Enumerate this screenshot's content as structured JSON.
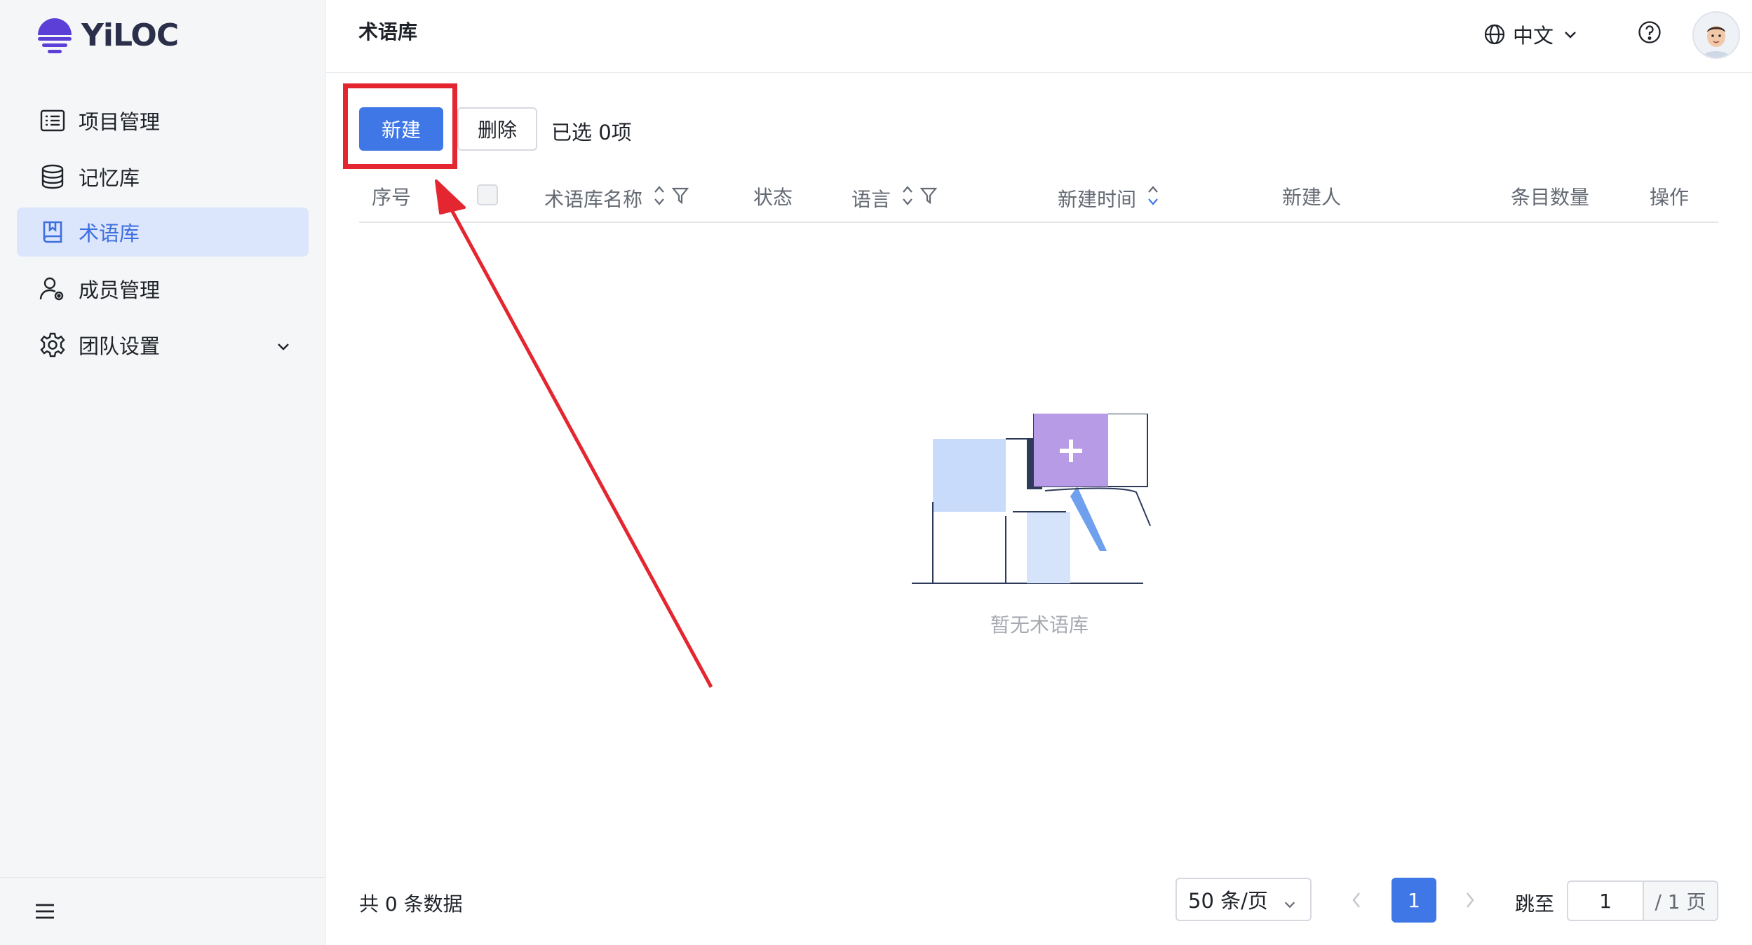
{
  "app": {
    "name": "YiLOC",
    "brand_color": "#5b3fd6",
    "accent": "#3f78e6"
  },
  "sidebar": {
    "items": [
      {
        "label": "项目管理",
        "icon": "project-list-icon"
      },
      {
        "label": "记忆库",
        "icon": "database-icon"
      },
      {
        "label": "术语库",
        "icon": "book-icon",
        "active": true
      },
      {
        "label": "成员管理",
        "icon": "member-icon"
      },
      {
        "label": "团队设置",
        "icon": "gear-icon",
        "expandable": true
      }
    ]
  },
  "header": {
    "title": "术语库",
    "language": "中文"
  },
  "toolbar": {
    "new_label": "新建",
    "delete_label": "删除",
    "selected_text": "已选 0项"
  },
  "table": {
    "columns": {
      "index": "序号",
      "name": "术语库名称",
      "status": "状态",
      "language": "语言",
      "created_time": "新建时间",
      "creator": "新建人",
      "entry_count": "条目数量",
      "actions": "操作"
    },
    "rows": [],
    "empty_text": "暂无术语库"
  },
  "footer": {
    "total_text": "共 0 条数据",
    "page_size": "50 条/页",
    "current_page": "1",
    "jump_label": "跳至",
    "jump_value": "1",
    "total_pages": "/ 1 页"
  },
  "annotation": {
    "color": "#e32630"
  }
}
